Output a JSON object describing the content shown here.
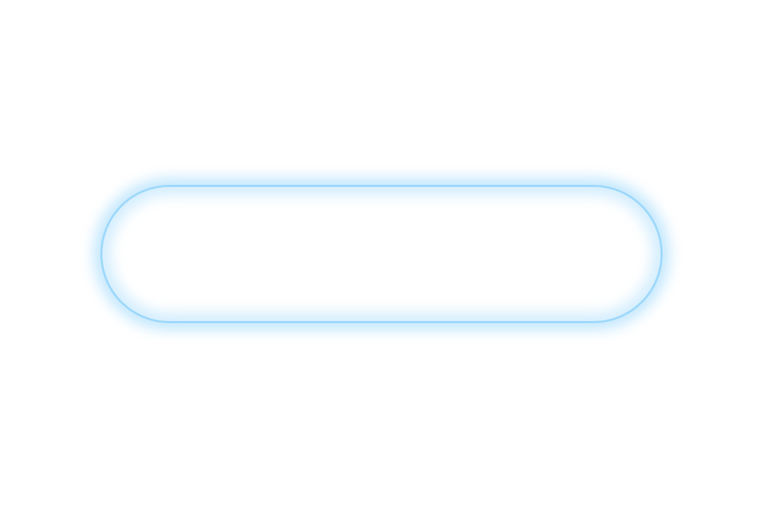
{
  "pill": {
    "label": ""
  },
  "colors": {
    "background": "#ffffff",
    "outline": "#9dd8fb",
    "glow": "#d6effd"
  }
}
